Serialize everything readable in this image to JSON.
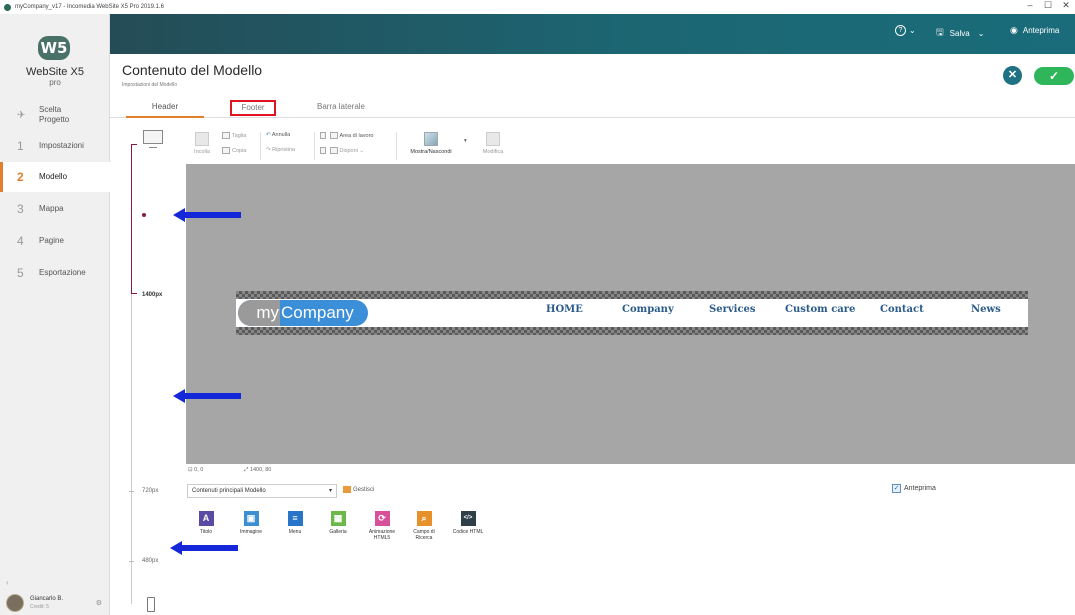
{
  "window": {
    "title": "myCompany_v17 - Incomedia WebSite X5 Pro 2019.1.6",
    "controls": [
      "–",
      "☐",
      "✕"
    ]
  },
  "sidebar": {
    "logo_badge": "W5",
    "logo_name": "WebSite X5",
    "logo_edition": "pro",
    "items": [
      {
        "num": "",
        "label": "Scelta Progetto"
      },
      {
        "num": "1",
        "label": "Impostazioni"
      },
      {
        "num": "2",
        "label": "Modello"
      },
      {
        "num": "3",
        "label": "Mappa"
      },
      {
        "num": "4",
        "label": "Pagine"
      },
      {
        "num": "5",
        "label": "Esportazione"
      }
    ],
    "collapse": "‹",
    "user": {
      "name": "Giancarlo B.",
      "sub": "Credit: 5"
    }
  },
  "topbar": {
    "help": "?",
    "save": "Salva",
    "preview": "Anteprima"
  },
  "page": {
    "title": "Contenuto del Modello",
    "subtitle": "Impostazioni del Modello",
    "close_glyph": "✕",
    "ok_glyph": "✓"
  },
  "tabs": [
    {
      "label": "Header"
    },
    {
      "label": "Footer"
    },
    {
      "label": "Barra laterale"
    }
  ],
  "rail": {
    "size_1400": "1400px",
    "size_720": "720px",
    "size_480": "480px"
  },
  "toolbar": {
    "paste": "Incolla",
    "cut": "Taglia",
    "copy": "Copia",
    "undo": "Annulla",
    "redo": "Ripristina",
    "work_area": "Area di lavoro",
    "arrange": "Disponi",
    "show_hide": "Mostra/Nascondi",
    "edit": "Modifica"
  },
  "canvas": {
    "logo_my": "my",
    "logo_company": "Company",
    "menu": [
      "HOME",
      "Company",
      "Services",
      "Custom care",
      "Contact",
      "News"
    ]
  },
  "status": {
    "position": "0, 0",
    "size": "1400, 80"
  },
  "objects_panel": {
    "select_value": "Contenuti principali Modello",
    "manage": "Gestisci",
    "preview_label": "Anteprima",
    "preview_checked": true,
    "items": [
      {
        "label": "Titolo",
        "icon": "A",
        "color": "#5b4aa3"
      },
      {
        "label": "Immagine",
        "icon": "▣",
        "color": "#3c8fd1"
      },
      {
        "label": "Menu",
        "icon": "≡",
        "color": "#2874c9"
      },
      {
        "label": "Galleria",
        "icon": "▦",
        "color": "#6cb84a"
      },
      {
        "label": "Animazione HTML5",
        "icon": "⟳",
        "color": "#d84f9a"
      },
      {
        "label": "Campo di Ricerca",
        "icon": "⌕",
        "color": "#e6912c"
      },
      {
        "label": "Codice HTML",
        "icon": "</>",
        "color": "#2e3f4a"
      }
    ]
  },
  "colors": {
    "accent": "#e07f2c",
    "highlight_box": "#e0141e",
    "arrow": "#1428d9",
    "topbar": "#1c6673"
  }
}
